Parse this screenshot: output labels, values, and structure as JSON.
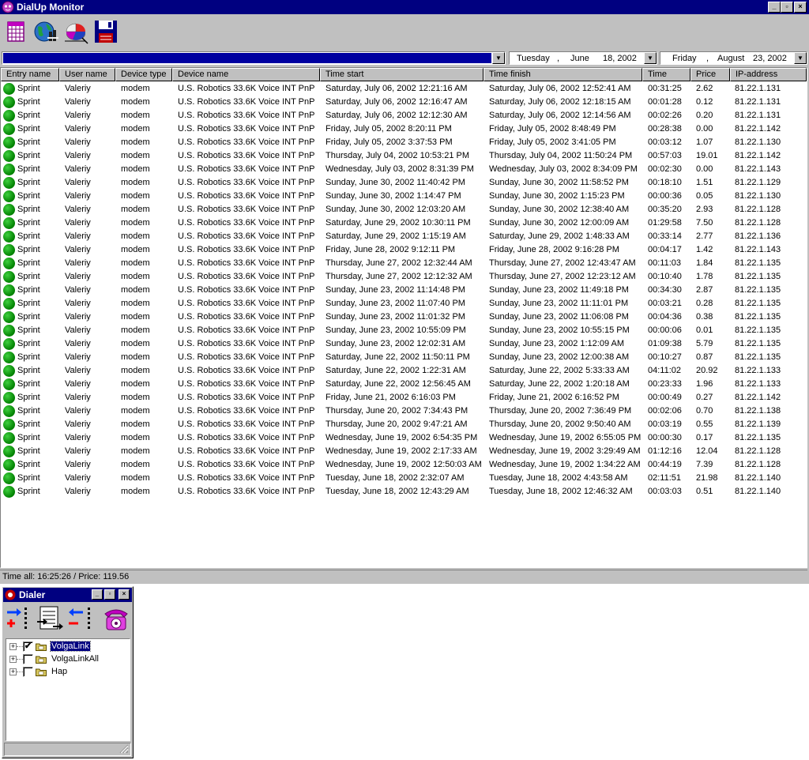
{
  "app": {
    "title": "DialUp Monitor"
  },
  "window_controls": {
    "minimize": "_",
    "restore": "▫",
    "close": "×"
  },
  "toolbar": {
    "buttons": [
      {
        "name": "calendar-report-icon"
      },
      {
        "name": "globe-network-icon"
      },
      {
        "name": "pie-chart-icon"
      },
      {
        "name": "floppy-save-icon"
      }
    ]
  },
  "filters": {
    "entry_combo_value": "",
    "date_from": {
      "day": "Tuesday",
      "sep": ",",
      "month": "June",
      "date": "18, 2002"
    },
    "date_to": {
      "day": "Friday",
      "sep": ",",
      "month": "August",
      "date": "23, 2002"
    }
  },
  "table": {
    "columns": [
      "Entry name",
      "User name",
      "Device type",
      "Device name",
      "Time start",
      "Time finish",
      "Time",
      "Price",
      "IP-address"
    ],
    "rows": [
      [
        "Sprint",
        "Valeriy",
        "modem",
        "U.S. Robotics 33.6K Voice INT PnP",
        "Saturday, July 06, 2002 12:21:16 AM",
        "Saturday, July 06, 2002 12:52:41 AM",
        "00:31:25",
        "2.62",
        "81.22.1.131"
      ],
      [
        "Sprint",
        "Valeriy",
        "modem",
        "U.S. Robotics 33.6K Voice INT PnP",
        "Saturday, July 06, 2002 12:16:47 AM",
        "Saturday, July 06, 2002 12:18:15 AM",
        "00:01:28",
        "0.12",
        "81.22.1.131"
      ],
      [
        "Sprint",
        "Valeriy",
        "modem",
        "U.S. Robotics 33.6K Voice INT PnP",
        "Saturday, July 06, 2002 12:12:30 AM",
        "Saturday, July 06, 2002 12:14:56 AM",
        "00:02:26",
        "0.20",
        "81.22.1.131"
      ],
      [
        "Sprint",
        "Valeriy",
        "modem",
        "U.S. Robotics 33.6K Voice INT PnP",
        "Friday, July 05, 2002 8:20:11 PM",
        "Friday, July 05, 2002 8:48:49 PM",
        "00:28:38",
        "0.00",
        "81.22.1.142"
      ],
      [
        "Sprint",
        "Valeriy",
        "modem",
        "U.S. Robotics 33.6K Voice INT PnP",
        "Friday, July 05, 2002 3:37:53 PM",
        "Friday, July 05, 2002 3:41:05 PM",
        "00:03:12",
        "1.07",
        "81.22.1.130"
      ],
      [
        "Sprint",
        "Valeriy",
        "modem",
        "U.S. Robotics 33.6K Voice INT PnP",
        "Thursday, July 04, 2002 10:53:21 PM",
        "Thursday, July 04, 2002 11:50:24 PM",
        "00:57:03",
        "19.01",
        "81.22.1.142"
      ],
      [
        "Sprint",
        "Valeriy",
        "modem",
        "U.S. Robotics 33.6K Voice INT PnP",
        "Wednesday, July 03, 2002 8:31:39 PM",
        "Wednesday, July 03, 2002 8:34:09 PM",
        "00:02:30",
        "0.00",
        "81.22.1.143"
      ],
      [
        "Sprint",
        "Valeriy",
        "modem",
        "U.S. Robotics 33.6K Voice INT PnP",
        "Sunday, June 30, 2002 11:40:42 PM",
        "Sunday, June 30, 2002 11:58:52 PM",
        "00:18:10",
        "1.51",
        "81.22.1.129"
      ],
      [
        "Sprint",
        "Valeriy",
        "modem",
        "U.S. Robotics 33.6K Voice INT PnP",
        "Sunday, June 30, 2002 1:14:47 PM",
        "Sunday, June 30, 2002 1:15:23 PM",
        "00:00:36",
        "0.05",
        "81.22.1.130"
      ],
      [
        "Sprint",
        "Valeriy",
        "modem",
        "U.S. Robotics 33.6K Voice INT PnP",
        "Sunday, June 30, 2002 12:03:20 AM",
        "Sunday, June 30, 2002 12:38:40 AM",
        "00:35:20",
        "2.93",
        "81.22.1.128"
      ],
      [
        "Sprint",
        "Valeriy",
        "modem",
        "U.S. Robotics 33.6K Voice INT PnP",
        "Saturday, June 29, 2002 10:30:11 PM",
        "Sunday, June 30, 2002 12:00:09 AM",
        "01:29:58",
        "7.50",
        "81.22.1.128"
      ],
      [
        "Sprint",
        "Valeriy",
        "modem",
        "U.S. Robotics 33.6K Voice INT PnP",
        "Saturday, June 29, 2002 1:15:19 AM",
        "Saturday, June 29, 2002 1:48:33 AM",
        "00:33:14",
        "2.77",
        "81.22.1.136"
      ],
      [
        "Sprint",
        "Valeriy",
        "modem",
        "U.S. Robotics 33.6K Voice INT PnP",
        "Friday, June 28, 2002 9:12:11 PM",
        "Friday, June 28, 2002 9:16:28 PM",
        "00:04:17",
        "1.42",
        "81.22.1.143"
      ],
      [
        "Sprint",
        "Valeriy",
        "modem",
        "U.S. Robotics 33.6K Voice INT PnP",
        "Thursday, June 27, 2002 12:32:44 AM",
        "Thursday, June 27, 2002 12:43:47 AM",
        "00:11:03",
        "1.84",
        "81.22.1.135"
      ],
      [
        "Sprint",
        "Valeriy",
        "modem",
        "U.S. Robotics 33.6K Voice INT PnP",
        "Thursday, June 27, 2002 12:12:32 AM",
        "Thursday, June 27, 2002 12:23:12 AM",
        "00:10:40",
        "1.78",
        "81.22.1.135"
      ],
      [
        "Sprint",
        "Valeriy",
        "modem",
        "U.S. Robotics 33.6K Voice INT PnP",
        "Sunday, June 23, 2002 11:14:48 PM",
        "Sunday, June 23, 2002 11:49:18 PM",
        "00:34:30",
        "2.87",
        "81.22.1.135"
      ],
      [
        "Sprint",
        "Valeriy",
        "modem",
        "U.S. Robotics 33.6K Voice INT PnP",
        "Sunday, June 23, 2002 11:07:40 PM",
        "Sunday, June 23, 2002 11:11:01 PM",
        "00:03:21",
        "0.28",
        "81.22.1.135"
      ],
      [
        "Sprint",
        "Valeriy",
        "modem",
        "U.S. Robotics 33.6K Voice INT PnP",
        "Sunday, June 23, 2002 11:01:32 PM",
        "Sunday, June 23, 2002 11:06:08 PM",
        "00:04:36",
        "0.38",
        "81.22.1.135"
      ],
      [
        "Sprint",
        "Valeriy",
        "modem",
        "U.S. Robotics 33.6K Voice INT PnP",
        "Sunday, June 23, 2002 10:55:09 PM",
        "Sunday, June 23, 2002 10:55:15 PM",
        "00:00:06",
        "0.01",
        "81.22.1.135"
      ],
      [
        "Sprint",
        "Valeriy",
        "modem",
        "U.S. Robotics 33.6K Voice INT PnP",
        "Sunday, June 23, 2002 12:02:31 AM",
        "Sunday, June 23, 2002 1:12:09 AM",
        "01:09:38",
        "5.79",
        "81.22.1.135"
      ],
      [
        "Sprint",
        "Valeriy",
        "modem",
        "U.S. Robotics 33.6K Voice INT PnP",
        "Saturday, June 22, 2002 11:50:11 PM",
        "Sunday, June 23, 2002 12:00:38 AM",
        "00:10:27",
        "0.87",
        "81.22.1.135"
      ],
      [
        "Sprint",
        "Valeriy",
        "modem",
        "U.S. Robotics 33.6K Voice INT PnP",
        "Saturday, June 22, 2002 1:22:31 AM",
        "Saturday, June 22, 2002 5:33:33 AM",
        "04:11:02",
        "20.92",
        "81.22.1.133"
      ],
      [
        "Sprint",
        "Valeriy",
        "modem",
        "U.S. Robotics 33.6K Voice INT PnP",
        "Saturday, June 22, 2002 12:56:45 AM",
        "Saturday, June 22, 2002 1:20:18 AM",
        "00:23:33",
        "1.96",
        "81.22.1.133"
      ],
      [
        "Sprint",
        "Valeriy",
        "modem",
        "U.S. Robotics 33.6K Voice INT PnP",
        "Friday, June 21, 2002 6:16:03 PM",
        "Friday, June 21, 2002 6:16:52 PM",
        "00:00:49",
        "0.27",
        "81.22.1.142"
      ],
      [
        "Sprint",
        "Valeriy",
        "modem",
        "U.S. Robotics 33.6K Voice INT PnP",
        "Thursday, June 20, 2002 7:34:43 PM",
        "Thursday, June 20, 2002 7:36:49 PM",
        "00:02:06",
        "0.70",
        "81.22.1.138"
      ],
      [
        "Sprint",
        "Valeriy",
        "modem",
        "U.S. Robotics 33.6K Voice INT PnP",
        "Thursday, June 20, 2002 9:47:21 AM",
        "Thursday, June 20, 2002 9:50:40 AM",
        "00:03:19",
        "0.55",
        "81.22.1.139"
      ],
      [
        "Sprint",
        "Valeriy",
        "modem",
        "U.S. Robotics 33.6K Voice INT PnP",
        "Wednesday, June 19, 2002 6:54:35 PM",
        "Wednesday, June 19, 2002 6:55:05 PM",
        "00:00:30",
        "0.17",
        "81.22.1.135"
      ],
      [
        "Sprint",
        "Valeriy",
        "modem",
        "U.S. Robotics 33.6K Voice INT PnP",
        "Wednesday, June 19, 2002 2:17:33 AM",
        "Wednesday, June 19, 2002 3:29:49 AM",
        "01:12:16",
        "12.04",
        "81.22.1.128"
      ],
      [
        "Sprint",
        "Valeriy",
        "modem",
        "U.S. Robotics 33.6K Voice INT PnP",
        "Wednesday, June 19, 2002 12:50:03 AM",
        "Wednesday, June 19, 2002 1:34:22 AM",
        "00:44:19",
        "7.39",
        "81.22.1.128"
      ],
      [
        "Sprint",
        "Valeriy",
        "modem",
        "U.S. Robotics 33.6K Voice INT PnP",
        "Tuesday, June 18, 2002 2:32:07 AM",
        "Tuesday, June 18, 2002 4:43:58 AM",
        "02:11:51",
        "21.98",
        "81.22.1.140"
      ],
      [
        "Sprint",
        "Valeriy",
        "modem",
        "U.S. Robotics 33.6K Voice INT PnP",
        "Tuesday, June 18, 2002 12:43:29 AM",
        "Tuesday, June 18, 2002 12:46:32 AM",
        "00:03:03",
        "0.51",
        "81.22.1.140"
      ]
    ]
  },
  "status": {
    "text": "Time all: 16:25:26 / Price: 119.56"
  },
  "dialer": {
    "title": "Dialer",
    "tools": [
      {
        "name": "add-connection-icon"
      },
      {
        "name": "edit-properties-icon"
      },
      {
        "name": "remove-connection-icon"
      },
      {
        "name": "telephone-dial-icon"
      }
    ],
    "tree": [
      {
        "label": "VolgaLink",
        "checked": true,
        "selected": true,
        "check_mark": "✔"
      },
      {
        "label": "VolgaLinkAll",
        "checked": false,
        "selected": false,
        "check_mark": ""
      },
      {
        "label": "Hap",
        "checked": false,
        "selected": false,
        "check_mark": ""
      }
    ],
    "expand_glyph": "+"
  },
  "colors": {
    "titlebar": "#000080",
    "face": "#c0c0c0",
    "status_dot": "#008000",
    "selection": "#000080"
  }
}
